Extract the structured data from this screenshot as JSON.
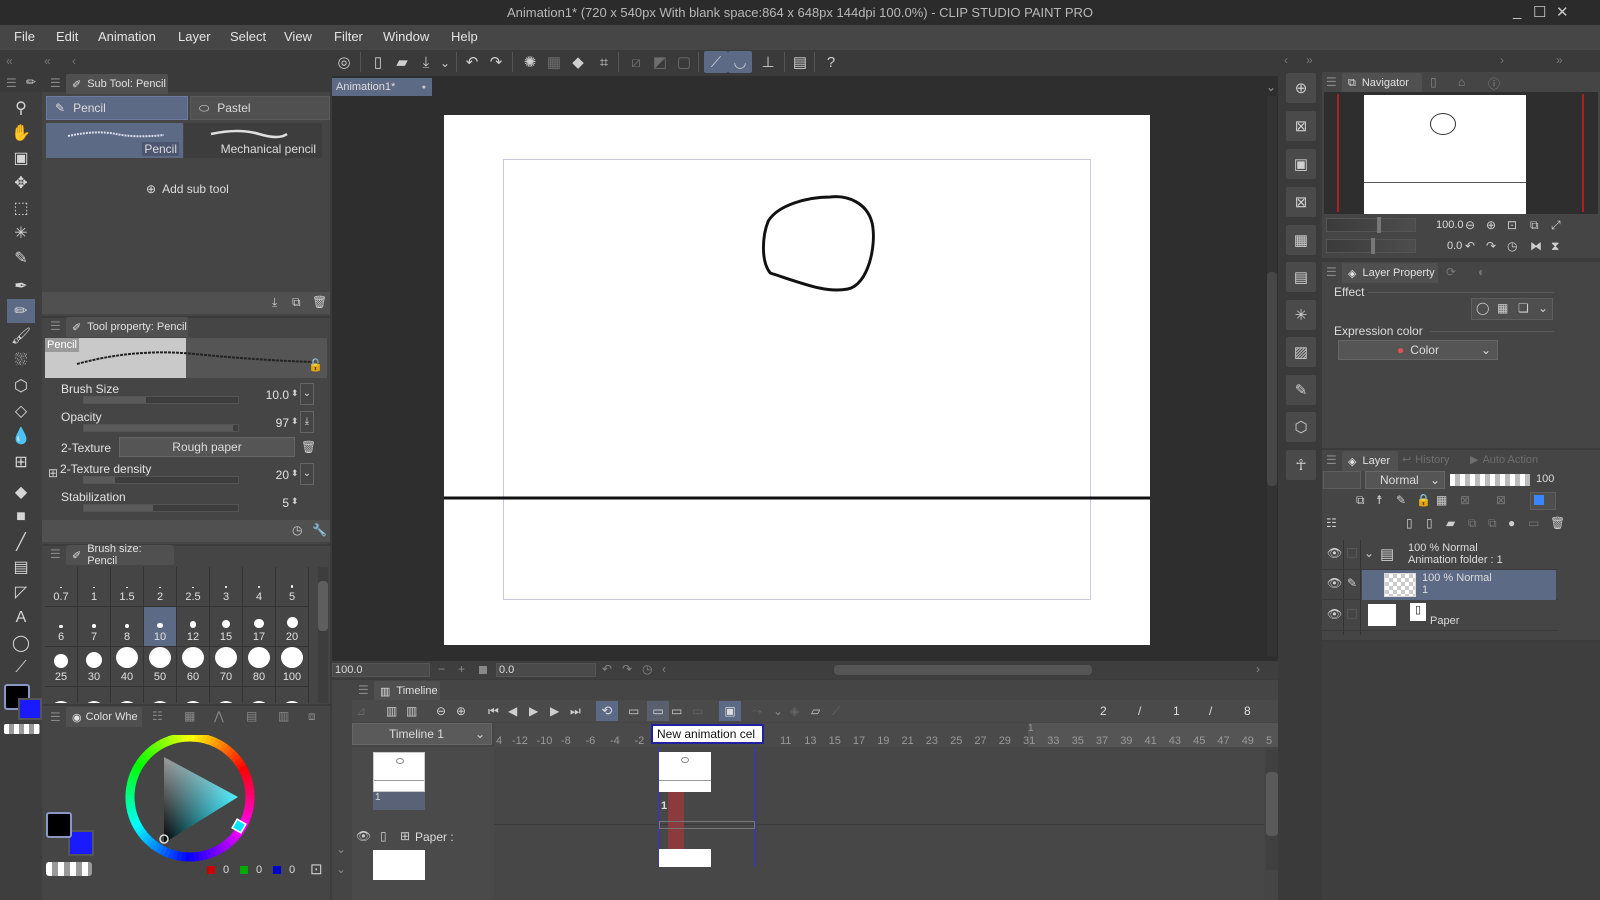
{
  "window": {
    "title": "Animation1* (720 x 540px With blank space:864 x 648px 144dpi 100.0%)  - CLIP STUDIO PAINT PRO",
    "controls": {
      "minimize": "_",
      "maximize": "☐",
      "close": "✕"
    }
  },
  "menu": [
    "File",
    "Edit",
    "Animation",
    "Layer",
    "Select",
    "View",
    "Filter",
    "Window",
    "Help"
  ],
  "command_bar": {
    "icons": [
      "clip-studio-icon",
      "new-icon",
      "open-icon",
      "save-icon",
      "undo-icon",
      "redo-icon",
      "deselect-icon",
      "show-selection-icon",
      "fill-icon",
      "transform-icon",
      "clear-outside-icon",
      "fill-selection-icon",
      "invert-selection-icon",
      "snap-ruler-icon",
      "snap-special-ruler-icon",
      "snap-grid-icon",
      "companion-icon",
      "help-icon"
    ]
  },
  "document_tab": {
    "label": "Animation1*",
    "modified_dot": "●"
  },
  "sub_tool": {
    "panel_title": "Sub Tool: Pencil",
    "groups": [
      {
        "label": "Pencil",
        "active": true
      },
      {
        "label": "Pastel",
        "active": false
      }
    ],
    "brushes": [
      {
        "label": "Pencil",
        "active": true
      },
      {
        "label": "Mechanical pencil",
        "active": false
      }
    ],
    "add_label": "Add sub tool"
  },
  "tool_property": {
    "panel_title": "Tool property: Pencil",
    "preview_label": "Pencil",
    "rows": [
      {
        "label": "Brush Size",
        "value": "10.0",
        "fill": 0.4
      },
      {
        "label": "Opacity",
        "value": "97",
        "fill": 0.97
      },
      {
        "label": "2-Texture",
        "value": "Rough paper"
      },
      {
        "label": "2-Texture density",
        "value": "20",
        "fill": 0.2
      },
      {
        "label": "Stabilization",
        "value": "5",
        "fill": 0.45
      }
    ]
  },
  "brush_size": {
    "panel_title": "Brush size: Pencil",
    "sizes": [
      "0.7",
      "1",
      "1.5",
      "2",
      "2.5",
      "3",
      "4",
      "5",
      "6",
      "7",
      "8",
      "10",
      "12",
      "15",
      "17",
      "20",
      "25",
      "30",
      "40",
      "50",
      "60",
      "70",
      "80",
      "100"
    ],
    "selected": "10"
  },
  "color": {
    "panel_title": "Color Whe",
    "main_color": "#000000",
    "sub_color": "#1a1aff",
    "rgb": {
      "r": "0",
      "g": "0",
      "b": "0"
    },
    "hue_color": "#00e5ff"
  },
  "canvas": {
    "zoom_value": "100.0",
    "rotate_value": "0.0"
  },
  "timeline": {
    "panel_title": "Timeline",
    "name": "Timeline 1",
    "frame_info": {
      "current": "2",
      "sep1": "/",
      "mid": "1",
      "sep2": "/",
      "total": "8"
    },
    "tooltip": "New animation cel",
    "ruler_left": [
      "4",
      "-12",
      "-10",
      "-8",
      "-6",
      "-4",
      "-2"
    ],
    "ruler_right": [
      "11",
      "13",
      "15",
      "17",
      "19",
      "21",
      "23",
      "25",
      "27",
      "29",
      "31",
      "33",
      "35",
      "37",
      "39",
      "41",
      "43",
      "45",
      "47",
      "49",
      "5"
    ],
    "marker_label": "1",
    "track_cel_label": "1",
    "cel_label": "1",
    "paper_label": "Paper :"
  },
  "navigator": {
    "panel_title": "Navigator",
    "zoom": "100.0",
    "rotation": "0.0"
  },
  "layer_property": {
    "panel_title": "Layer Property",
    "effect_label": "Effect",
    "expression_label": "Expression color",
    "expression_value": "Color"
  },
  "layer_panel": {
    "tabs": [
      "Layer",
      "History",
      "Auto Action"
    ],
    "blend_mode": "Normal",
    "opacity": "100",
    "layers": [
      {
        "line1": "100 % Normal",
        "line2": "Animation folder : 1",
        "type": "folder",
        "selected": false
      },
      {
        "line1": "100 % Normal",
        "line2": "1",
        "type": "raster",
        "selected": true
      },
      {
        "line1": "",
        "line2": "Paper",
        "type": "paper",
        "selected": false
      }
    ]
  }
}
